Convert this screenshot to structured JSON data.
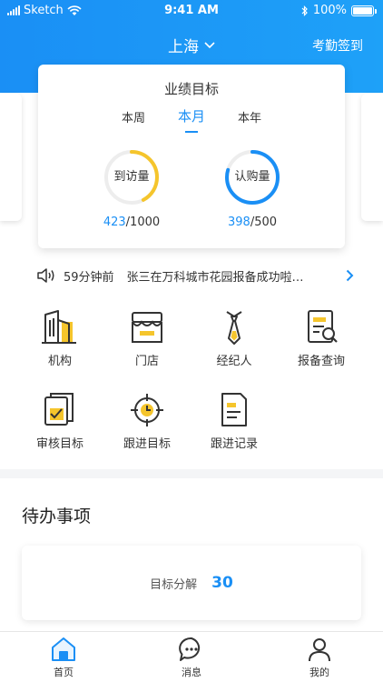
{
  "status_bar": {
    "carrier": "Sketch",
    "time": "9:41 AM",
    "battery": "100%"
  },
  "nav": {
    "city": "上海",
    "attendance": "考勤签到"
  },
  "performance": {
    "title": "业绩目标",
    "tabs": [
      {
        "label": "本周",
        "active": false
      },
      {
        "label": "本月",
        "active": true
      },
      {
        "label": "本年",
        "active": false
      }
    ],
    "metrics": [
      {
        "label": "到访量",
        "value": "423",
        "target": "/1000",
        "progress": 0.423,
        "color": "#f5c52c"
      },
      {
        "label": "认购量",
        "value": "398",
        "target": "/500",
        "progress": 0.796,
        "color": "#1a8ff5"
      }
    ]
  },
  "notice": {
    "time": "59分钟前",
    "text": "张三在万科城市花园报备成功啦…"
  },
  "grid": [
    {
      "label": "机构",
      "icon": "building-icon"
    },
    {
      "label": "门店",
      "icon": "store-icon"
    },
    {
      "label": "经纪人",
      "icon": "tie-icon"
    },
    {
      "label": "报备查询",
      "icon": "document-search-icon"
    },
    {
      "label": "审核目标",
      "icon": "review-icon"
    },
    {
      "label": "跟进目标",
      "icon": "target-icon"
    },
    {
      "label": "跟进记录",
      "icon": "record-icon"
    }
  ],
  "todo": {
    "title": "待办事项",
    "item_label": "目标分解",
    "item_count": "30"
  },
  "tabbar": [
    {
      "label": "首页",
      "icon": "home-icon",
      "active": true
    },
    {
      "label": "消息",
      "icon": "message-icon",
      "active": false
    },
    {
      "label": "我的",
      "icon": "user-icon",
      "active": false
    }
  ],
  "colors": {
    "primary": "#1a8ff5",
    "accent_yellow": "#f5c52c"
  }
}
